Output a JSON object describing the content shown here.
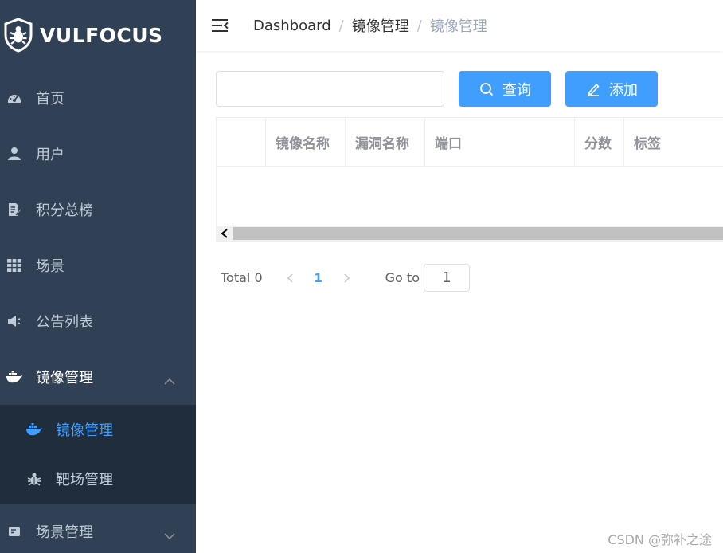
{
  "app": {
    "logo_text": "VULFOCUS"
  },
  "sidebar": {
    "items": [
      {
        "label": "首页",
        "icon": "dashboard-icon"
      },
      {
        "label": "用户",
        "icon": "user-icon"
      },
      {
        "label": "积分总榜",
        "icon": "document-edit-icon"
      },
      {
        "label": "场景",
        "icon": "table-grid-icon"
      },
      {
        "label": "公告列表",
        "icon": "megaphone-icon"
      },
      {
        "label": "镜像管理",
        "icon": "docker-whale-icon",
        "expanded": true
      },
      {
        "label": "场景管理",
        "icon": "scene-card-icon",
        "expanded": false
      }
    ],
    "submenu": [
      {
        "label": "镜像管理",
        "icon": "docker-whale-icon",
        "active": true
      },
      {
        "label": "靶场管理",
        "icon": "bug-icon",
        "active": false
      }
    ],
    "active_color": "#409eff",
    "bg_color": "#304156"
  },
  "navbar": {
    "breadcrumb": [
      "Dashboard",
      "镜像管理",
      "镜像管理"
    ]
  },
  "toolbar": {
    "search_value": "",
    "query_label": "查询",
    "add_label": "添加"
  },
  "table": {
    "columns": [
      "",
      "镜像名称",
      "漏洞名称",
      "端口",
      "分数",
      "标签"
    ],
    "rows": []
  },
  "pagination": {
    "total_text": "Total 0",
    "current_page": "1",
    "goto_label": "Go to",
    "goto_value": "1"
  },
  "watermark": "CSDN @弥补之途"
}
